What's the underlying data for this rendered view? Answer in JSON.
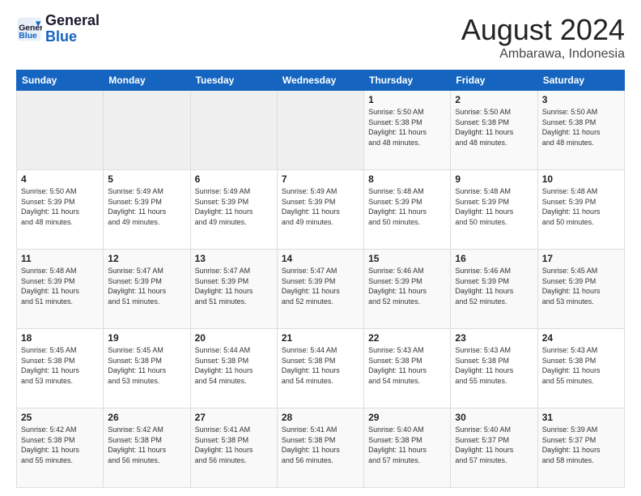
{
  "logo": {
    "line1": "General",
    "line2": "Blue"
  },
  "title": "August 2024",
  "subtitle": "Ambarawa, Indonesia",
  "days_header": [
    "Sunday",
    "Monday",
    "Tuesday",
    "Wednesday",
    "Thursday",
    "Friday",
    "Saturday"
  ],
  "weeks": [
    [
      {
        "day": "",
        "info": ""
      },
      {
        "day": "",
        "info": ""
      },
      {
        "day": "",
        "info": ""
      },
      {
        "day": "",
        "info": ""
      },
      {
        "day": "1",
        "info": "Sunrise: 5:50 AM\nSunset: 5:38 PM\nDaylight: 11 hours\nand 48 minutes."
      },
      {
        "day": "2",
        "info": "Sunrise: 5:50 AM\nSunset: 5:38 PM\nDaylight: 11 hours\nand 48 minutes."
      },
      {
        "day": "3",
        "info": "Sunrise: 5:50 AM\nSunset: 5:38 PM\nDaylight: 11 hours\nand 48 minutes."
      }
    ],
    [
      {
        "day": "4",
        "info": "Sunrise: 5:50 AM\nSunset: 5:39 PM\nDaylight: 11 hours\nand 48 minutes."
      },
      {
        "day": "5",
        "info": "Sunrise: 5:49 AM\nSunset: 5:39 PM\nDaylight: 11 hours\nand 49 minutes."
      },
      {
        "day": "6",
        "info": "Sunrise: 5:49 AM\nSunset: 5:39 PM\nDaylight: 11 hours\nand 49 minutes."
      },
      {
        "day": "7",
        "info": "Sunrise: 5:49 AM\nSunset: 5:39 PM\nDaylight: 11 hours\nand 49 minutes."
      },
      {
        "day": "8",
        "info": "Sunrise: 5:48 AM\nSunset: 5:39 PM\nDaylight: 11 hours\nand 50 minutes."
      },
      {
        "day": "9",
        "info": "Sunrise: 5:48 AM\nSunset: 5:39 PM\nDaylight: 11 hours\nand 50 minutes."
      },
      {
        "day": "10",
        "info": "Sunrise: 5:48 AM\nSunset: 5:39 PM\nDaylight: 11 hours\nand 50 minutes."
      }
    ],
    [
      {
        "day": "11",
        "info": "Sunrise: 5:48 AM\nSunset: 5:39 PM\nDaylight: 11 hours\nand 51 minutes."
      },
      {
        "day": "12",
        "info": "Sunrise: 5:47 AM\nSunset: 5:39 PM\nDaylight: 11 hours\nand 51 minutes."
      },
      {
        "day": "13",
        "info": "Sunrise: 5:47 AM\nSunset: 5:39 PM\nDaylight: 11 hours\nand 51 minutes."
      },
      {
        "day": "14",
        "info": "Sunrise: 5:47 AM\nSunset: 5:39 PM\nDaylight: 11 hours\nand 52 minutes."
      },
      {
        "day": "15",
        "info": "Sunrise: 5:46 AM\nSunset: 5:39 PM\nDaylight: 11 hours\nand 52 minutes."
      },
      {
        "day": "16",
        "info": "Sunrise: 5:46 AM\nSunset: 5:39 PM\nDaylight: 11 hours\nand 52 minutes."
      },
      {
        "day": "17",
        "info": "Sunrise: 5:45 AM\nSunset: 5:39 PM\nDaylight: 11 hours\nand 53 minutes."
      }
    ],
    [
      {
        "day": "18",
        "info": "Sunrise: 5:45 AM\nSunset: 5:38 PM\nDaylight: 11 hours\nand 53 minutes."
      },
      {
        "day": "19",
        "info": "Sunrise: 5:45 AM\nSunset: 5:38 PM\nDaylight: 11 hours\nand 53 minutes."
      },
      {
        "day": "20",
        "info": "Sunrise: 5:44 AM\nSunset: 5:38 PM\nDaylight: 11 hours\nand 54 minutes."
      },
      {
        "day": "21",
        "info": "Sunrise: 5:44 AM\nSunset: 5:38 PM\nDaylight: 11 hours\nand 54 minutes."
      },
      {
        "day": "22",
        "info": "Sunrise: 5:43 AM\nSunset: 5:38 PM\nDaylight: 11 hours\nand 54 minutes."
      },
      {
        "day": "23",
        "info": "Sunrise: 5:43 AM\nSunset: 5:38 PM\nDaylight: 11 hours\nand 55 minutes."
      },
      {
        "day": "24",
        "info": "Sunrise: 5:43 AM\nSunset: 5:38 PM\nDaylight: 11 hours\nand 55 minutes."
      }
    ],
    [
      {
        "day": "25",
        "info": "Sunrise: 5:42 AM\nSunset: 5:38 PM\nDaylight: 11 hours\nand 55 minutes."
      },
      {
        "day": "26",
        "info": "Sunrise: 5:42 AM\nSunset: 5:38 PM\nDaylight: 11 hours\nand 56 minutes."
      },
      {
        "day": "27",
        "info": "Sunrise: 5:41 AM\nSunset: 5:38 PM\nDaylight: 11 hours\nand 56 minutes."
      },
      {
        "day": "28",
        "info": "Sunrise: 5:41 AM\nSunset: 5:38 PM\nDaylight: 11 hours\nand 56 minutes."
      },
      {
        "day": "29",
        "info": "Sunrise: 5:40 AM\nSunset: 5:38 PM\nDaylight: 11 hours\nand 57 minutes."
      },
      {
        "day": "30",
        "info": "Sunrise: 5:40 AM\nSunset: 5:37 PM\nDaylight: 11 hours\nand 57 minutes."
      },
      {
        "day": "31",
        "info": "Sunrise: 5:39 AM\nSunset: 5:37 PM\nDaylight: 11 hours\nand 58 minutes."
      }
    ]
  ]
}
